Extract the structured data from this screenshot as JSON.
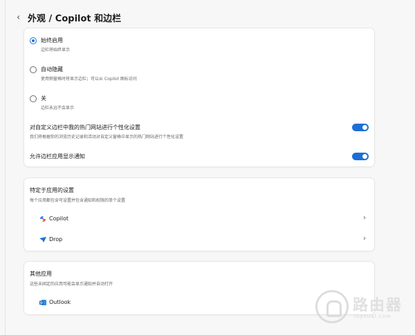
{
  "header": {
    "back_icon": "chevron-left-icon",
    "title": "外观 / Copilot 和边栏"
  },
  "sidebar_mode": {
    "options": [
      {
        "label": "始终启用",
        "description": "边栏将始终显示",
        "checked": true
      },
      {
        "label": "自动隐藏",
        "description": "使用侧窗格时将显示边栏；可以从 Copilot 图标访问",
        "checked": false
      },
      {
        "label": "关",
        "description": "边栏永远不会显示",
        "checked": false
      }
    ]
  },
  "personalize": {
    "label": "对自定义边栏中我的热门网站进行个性化设置",
    "description": "我们将根据你的浏览历史记录和活动对自定义窗格中显示的热门网站进行个性化设置",
    "enabled": true
  },
  "notifications": {
    "label": "允许边栏应用显示通知",
    "enabled": true
  },
  "app_settings": {
    "title": "特定于应用的设置",
    "description": "每个应用都包含可设置并包含通知和权限的单个设置",
    "apps": [
      {
        "name": "Copilot",
        "icon": "copilot-icon"
      },
      {
        "name": "Drop",
        "icon": "drop-icon"
      }
    ]
  },
  "other_apps": {
    "title": "其他应用",
    "description": "这些未固定的应用可能会显示通知并自动打开",
    "apps": [
      {
        "name": "Outlook",
        "icon": "outlook-icon"
      }
    ]
  },
  "watermark": {
    "text": "路由器",
    "subtext": "luyouqi.com"
  },
  "colors": {
    "accent": "#1d6fd6",
    "background": "#f7f7f7",
    "card": "#ffffff"
  }
}
